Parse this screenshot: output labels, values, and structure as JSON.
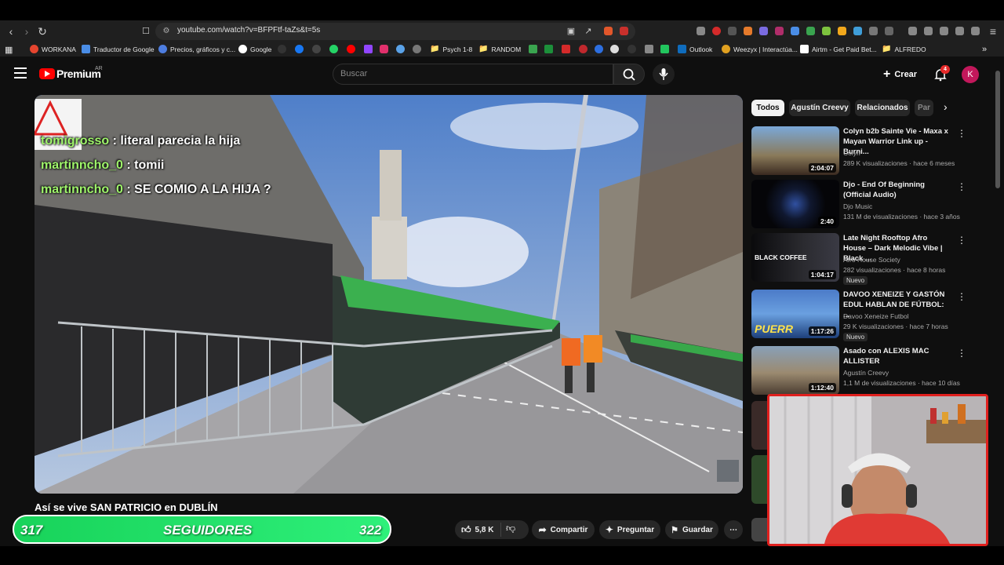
{
  "browser": {
    "url": "youtube.com/watch?v=BFPFtf-taZs&t=5s",
    "bookmarks": [
      "WORKANA",
      "Traductor de Google",
      "Precios, gráficos y c...",
      "Google",
      "Psych 1-8",
      "RANDOM",
      "Outlook",
      "Weezyx | Interactúa...",
      "Airtm - Get Paid Bet...",
      "ALFREDO"
    ]
  },
  "header": {
    "logo_text": "Premium",
    "region": "AR",
    "search_placeholder": "Buscar",
    "create_label": "Crear",
    "notif_count": "4",
    "avatar_letter": "K"
  },
  "chat": [
    {
      "user": "tomigrosso",
      "msg": "literal parecia la hija"
    },
    {
      "user": "martinncho_0",
      "msg": "tomii"
    },
    {
      "user": "martinncho_0",
      "msg": "SE COMIO A LA HIJA ?"
    }
  ],
  "video": {
    "title": "Así se vive SAN PATRICIO en DUBLÍN"
  },
  "followers": {
    "left": "317",
    "label": "SEGUIDORES",
    "right": "322"
  },
  "actions": {
    "likes": "5,8 K",
    "share": "Compartir",
    "ask": "Preguntar",
    "save": "Guardar"
  },
  "chips": [
    "Todos",
    "Agustín Creevy",
    "Relacionados",
    "Par"
  ],
  "recommended": [
    {
      "title": "Colyn b2b Sainte Vie - Maxa x Mayan Warrior Link up - Burni...",
      "channel": "Colyn",
      "meta": "289 K visualizaciones · hace 6 meses",
      "duration": "2:04:07",
      "badge": ""
    },
    {
      "title": "Djo - End Of Beginning (Official Audio)",
      "channel": "Djo Music",
      "meta": "131 M de visualizaciones · hace 3 años",
      "duration": "2:40",
      "badge": ""
    },
    {
      "title": "Late Night Rooftop Afro House – Dark Melodic Vibe | Black ...",
      "channel": "Afro House Society",
      "meta": "282 visualizaciones · hace 8 horas",
      "duration": "1:04:17",
      "badge": "Nuevo",
      "thumb_text": "BLACK COFFEE"
    },
    {
      "title": "DAVOO XENEIZE Y GASTÓN EDUL HABLAN DE FÚTBOL: ...",
      "channel": "Davoo Xeneize Futbol",
      "meta": "29 K visualizaciones · hace 7 horas",
      "duration": "1:17:26",
      "badge": "Nuevo",
      "thumb_text": "PUERR"
    },
    {
      "title": "Asado con ALEXIS MAC ALLISTER",
      "channel": "Agustín Creevy",
      "meta": "1,1 M de visualizaciones · hace 10 días",
      "duration": "1:12:40",
      "badge": ""
    }
  ],
  "colors": {
    "accent_red": "#ff0000",
    "chat_user": "#9ff56b",
    "followers_green": "#22e06a",
    "webcam_border": "#e0201e"
  }
}
